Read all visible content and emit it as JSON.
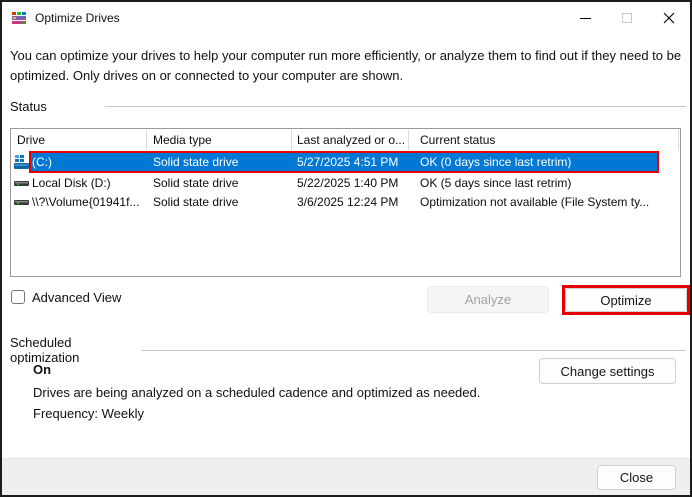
{
  "window": {
    "title": "Optimize Drives"
  },
  "intro": {
    "line1": "You can optimize your drives to help your computer run more efficiently, or analyze them to find out if they need to be",
    "line2": "optimized. Only drives on or connected to your computer are shown."
  },
  "status": {
    "heading": "Status"
  },
  "table": {
    "columns": [
      "Drive",
      "Media type",
      "Last analyzed or o...",
      "Current status"
    ],
    "rows": [
      {
        "selected": true,
        "cells": [
          "(C:)",
          "Solid state drive",
          "5/27/2025 4:51 PM",
          "OK (0 days since last retrim)"
        ]
      },
      {
        "selected": false,
        "cells": [
          "Local Disk (D:)",
          "Solid state drive",
          "5/22/2025 1:40 PM",
          "OK (5 days since last retrim)"
        ]
      },
      {
        "selected": false,
        "cells": [
          "\\\\?\\Volume{01941f...",
          "Solid state drive",
          "3/6/2025 12:24 PM",
          "Optimization not available (File System ty..."
        ]
      }
    ]
  },
  "advanced_view": {
    "label": "Advanced View",
    "checked": false
  },
  "actions": {
    "analyze": "Analyze",
    "optimize": "Optimize"
  },
  "scheduled": {
    "heading": "Scheduled optimization",
    "state": "On",
    "description": "Drives are being analyzed on a scheduled cadence and optimized as needed.",
    "frequency": "Frequency: Weekly",
    "change_button": "Change settings"
  },
  "footer": {
    "close": "Close"
  },
  "colors": {
    "selection_blue": "#0078d4",
    "annotation_red": "#e60000",
    "footer_gray": "#efefef"
  }
}
